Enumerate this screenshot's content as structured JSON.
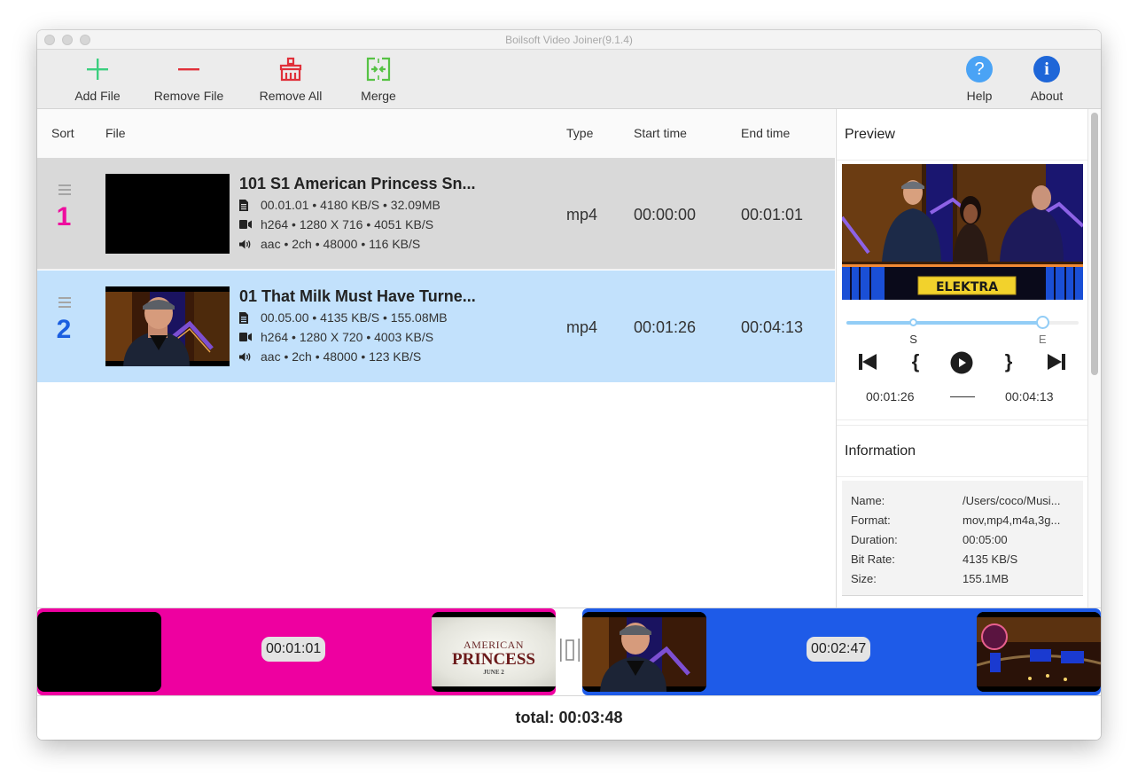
{
  "window": {
    "title": "Boilsoft Video Joiner(9.1.4)"
  },
  "toolbar": {
    "add_file": "Add File",
    "remove_file": "Remove File",
    "remove_all": "Remove All",
    "merge": "Merge",
    "help": "Help",
    "about": "About",
    "colors": {
      "add": "#3ccf7f",
      "remove": "#e0303a",
      "merge": "#56c244",
      "help": "#4aa3f5",
      "about": "#1e66d8"
    }
  },
  "list": {
    "headers": {
      "sort": "Sort",
      "file": "File",
      "type": "Type",
      "start": "Start time",
      "end": "End time"
    },
    "rows": [
      {
        "index": "1",
        "index_color": "#ee0d9e",
        "row_bg": "#d9d9d9",
        "name": "101 S1 American Princess Sn...",
        "file_info": "00.01.01 •  4180 KB/S • 32.09MB",
        "video_info": "h264 • 1280 X 716 • 4051 KB/S",
        "audio_info": "aac • 2ch • 48000 • 116 KB/S",
        "type": "mp4",
        "start": "00:00:00",
        "end": "00:01:01",
        "selected": false
      },
      {
        "index": "2",
        "index_color": "#1a5ee0",
        "row_bg": "#c2e1fc",
        "name": "01 That Milk Must Have Turne...",
        "file_info": "00.05.00 •  4135 KB/S • 155.08MB",
        "video_info": "h264 • 1280 X 720 • 4003 KB/S",
        "audio_info": "aac • 2ch • 48000 • 123 KB/S",
        "type": "mp4",
        "start": "00:01:26",
        "end": "00:04:13",
        "selected": true
      }
    ]
  },
  "preview": {
    "title": "Preview",
    "caption": "ELEKTRA",
    "slider": {
      "start_fraction": 0.287,
      "end_fraction": 0.843,
      "start_label": "S",
      "end_label": "E"
    },
    "start_time": "00:01:26",
    "end_time": "00:04:13",
    "separator": "——"
  },
  "information": {
    "title": "Information",
    "rows": [
      {
        "key": "Name:",
        "value": "/Users/coco/Musi..."
      },
      {
        "key": "Format:",
        "value": "mov,mp4,m4a,3g..."
      },
      {
        "key": "Duration:",
        "value": "00:05:00"
      },
      {
        "key": "Bit Rate:",
        "value": "4135 KB/S"
      },
      {
        "key": "Size:",
        "value": "155.1MB"
      }
    ]
  },
  "timeline": {
    "clips": [
      {
        "duration": "00:01:01",
        "color": "#ee00a0",
        "end_thumb_text": [
          "AMERICAN",
          "PRINCESS",
          "JUNE 2"
        ]
      },
      {
        "duration": "00:02:47",
        "color": "#1e5be8"
      }
    ]
  },
  "footer": {
    "total": "total: 00:03:48"
  }
}
